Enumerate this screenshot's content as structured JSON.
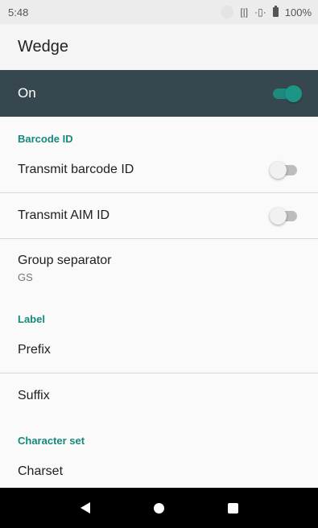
{
  "status_bar": {
    "time": "5:48",
    "battery": "100%",
    "icons": [
      "scanner-icon",
      "vibrate-icon",
      "battery-icon"
    ]
  },
  "app_bar": {
    "title": "Wedge"
  },
  "master_switch": {
    "label": "On",
    "state": "on",
    "accent": "#1b9686"
  },
  "sections": {
    "barcode_id": {
      "header": "Barcode ID",
      "transmit_barcode_id": {
        "label": "Transmit barcode ID",
        "state": "off"
      },
      "transmit_aim_id": {
        "label": "Transmit AIM ID",
        "state": "off"
      },
      "group_separator": {
        "label": "Group separator",
        "value": "GS"
      }
    },
    "label": {
      "header": "Label",
      "prefix": {
        "label": "Prefix"
      },
      "suffix": {
        "label": "Suffix"
      }
    },
    "character_set": {
      "header": "Character set",
      "charset": {
        "label": "Charset"
      }
    }
  },
  "nav_bar": {
    "buttons": [
      "back",
      "home",
      "recents"
    ]
  },
  "colors": {
    "header_bg": "#37474f",
    "section_header": "#16897c"
  }
}
